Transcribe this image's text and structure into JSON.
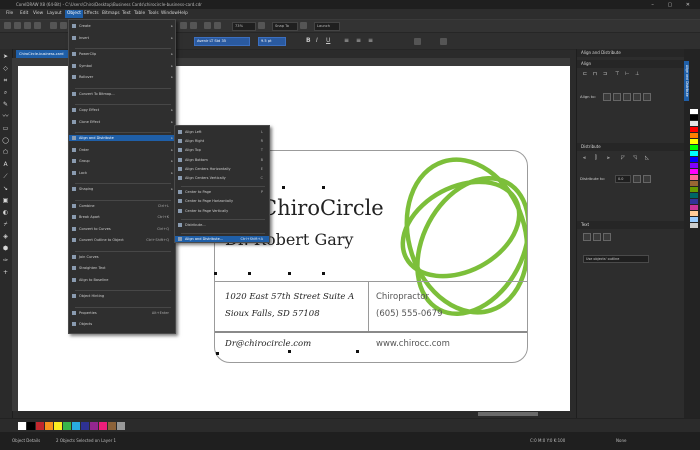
{
  "window": {
    "title": "CorelDRAW X8 (64-Bit) - C:\\Users\\Chiro\\Desktop\\Business Cards\\chirocircle-business-card.cdr",
    "controls": "–  ▢  ✕"
  },
  "menubar": [
    "File",
    "Edit",
    "View",
    "Layout",
    "Object",
    "Effects",
    "Bitmaps",
    "Text",
    "Table",
    "Tools",
    "Window",
    "Help"
  ],
  "active_menu": "Object",
  "toolbar": {
    "zoom": "73%",
    "snap_label": "Snap To",
    "launch_label": "Launch"
  },
  "propbar": {
    "font": "Avenir LT Std 35",
    "size": "9.5 pt",
    "glyphs": [
      "B",
      "I",
      "U",
      "≡",
      "≡",
      "≡"
    ]
  },
  "document_tab": "ChiroCircle-business-card",
  "object_menu": {
    "items": [
      {
        "label": "Create",
        "arrow": "▸"
      },
      {
        "label": "Insert",
        "arrow": "▸"
      },
      {
        "label": "PowerClip",
        "arrow": "▸"
      },
      {
        "label": "Symbol",
        "arrow": "▸"
      },
      {
        "label": "Rollover",
        "arrow": "▸"
      },
      {
        "label": "Convert To Bitmap..."
      },
      {
        "label": "Copy Effect",
        "arrow": "▸"
      },
      {
        "label": "Clone Effect",
        "arrow": "▸"
      },
      {
        "label": "Align and Distribute",
        "arrow": "▸",
        "highlight": true
      },
      {
        "label": "Order",
        "arrow": "▸"
      },
      {
        "label": "Group",
        "arrow": "▸"
      },
      {
        "label": "Lock",
        "arrow": "▸"
      },
      {
        "label": "Shaping",
        "arrow": "▸"
      },
      {
        "label": "Combine",
        "shortcut": "Ctrl+L"
      },
      {
        "label": "Break Apart",
        "shortcut": "Ctrl+K"
      },
      {
        "label": "Convert to Curves",
        "shortcut": "Ctrl+Q"
      },
      {
        "label": "Convert Outline to Object",
        "shortcut": "Ctrl+Shift+Q"
      },
      {
        "label": "Join Curves"
      },
      {
        "label": "Straighten Text"
      },
      {
        "label": "Align to Baseline"
      },
      {
        "label": "Object Hinting"
      },
      {
        "label": "Properties",
        "shortcut": "Alt+Enter"
      },
      {
        "label": "Objects"
      }
    ]
  },
  "align_submenu": {
    "items": [
      {
        "label": "Align Left",
        "shortcut": "L"
      },
      {
        "label": "Align Right",
        "shortcut": "R"
      },
      {
        "label": "Align Top",
        "shortcut": "T"
      },
      {
        "label": "Align Bottom",
        "shortcut": "B"
      },
      {
        "label": "Align Centers Horizontally",
        "shortcut": "E"
      },
      {
        "label": "Align Centers Vertically",
        "shortcut": "C"
      },
      {
        "label": "Center to Page",
        "shortcut": "P"
      },
      {
        "label": "Center to Page Horizontally"
      },
      {
        "label": "Center to Page Vertically"
      },
      {
        "label": "Distribute...",
        "shortcut": ""
      },
      {
        "label": "Align and Distribute...",
        "shortcut": "Ctrl+Shift+A",
        "highlight": true
      }
    ]
  },
  "card": {
    "brand": "ChiroCircle",
    "name": "Dr. Robert Gary",
    "address1": "1020 East 57th Street Suite A",
    "address2": "Sioux Falls, SD 57108",
    "title": "Chiropractor",
    "phone": "(605) 555-0679",
    "email": "Dr@chirocircle.com",
    "website": "www.chirocc.com",
    "accent": "#7cbf3a"
  },
  "right_panel": {
    "title": "Align and Distribute",
    "align_label": "Align",
    "align_to_label": "Align to:",
    "distribute_label": "Distribute",
    "distribute_to_label": "Distribute to:",
    "spacing_value": "0.0",
    "text_label": "Text",
    "use_objects_label": "Use objects' outline"
  },
  "palette": [
    "#ffffff",
    "#000000",
    "#c1272d",
    "#f7931e",
    "#fcee21",
    "#39b54a",
    "#29abe2",
    "#2e3192",
    "#93278f",
    "#ed1e79",
    "#8c6239",
    "#999999"
  ],
  "strip_colors": [
    "#ffffff",
    "#000000",
    "#e6e6e6",
    "#ff0000",
    "#ff7f00",
    "#ffff00",
    "#00ff00",
    "#00ffff",
    "#0000ff",
    "#8000ff",
    "#ff00ff",
    "#ff6699",
    "#996633",
    "#669900",
    "#006666",
    "#333399",
    "#cc3399",
    "#ffcc99",
    "#99ccff",
    "#cccccc"
  ],
  "status": {
    "left": "Object Details",
    "middle": "2 Objects Selected on Layer 1",
    "coords": "C:0 M:0 Y:0 K:100",
    "fill_label": "None"
  }
}
